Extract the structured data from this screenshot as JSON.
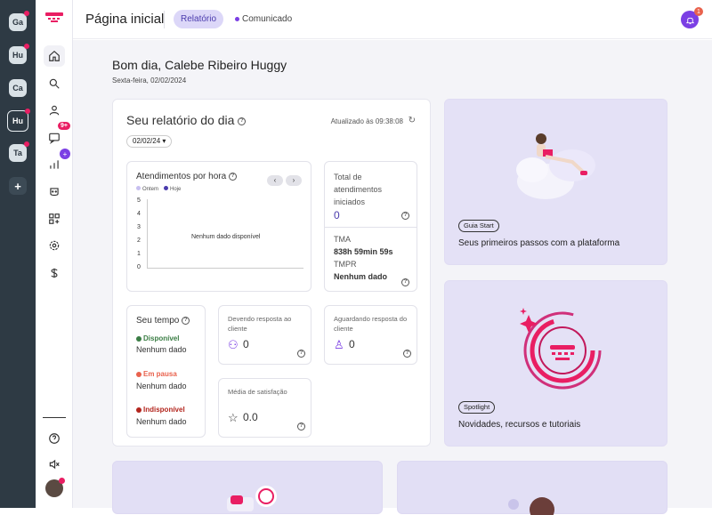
{
  "workspaces": [
    {
      "label": "Ga",
      "dot": true
    },
    {
      "label": "Hu",
      "dot": true
    },
    {
      "label": "Ca",
      "dot": false
    },
    {
      "label": "Hu",
      "dot": true,
      "active": true
    },
    {
      "label": "Ta",
      "dot": true
    }
  ],
  "workspace_add": "+",
  "nav": {
    "chat_badge": "9+",
    "stats_badge": "+"
  },
  "header": {
    "title": "Página inicial",
    "tab_report": "Relatório",
    "tab_notice": "Comunicado",
    "notification_count": "1"
  },
  "greeting": "Bom dia, Calebe Ribeiro Huggy",
  "date": "Sexta-feira, 02/02/2024",
  "report": {
    "title": "Seu relatório do dia",
    "updated": "Atualizado às 09:38:08",
    "date_select": "02/02/24",
    "hourly": {
      "title": "Atendimentos por hora",
      "legend_yesterday": "Ontem",
      "legend_today": "Hoje",
      "prev": "‹",
      "next": "›",
      "y_ticks": [
        "5",
        "4",
        "3",
        "2",
        "1",
        "0"
      ],
      "empty": "Nenhum dado disponível"
    },
    "total": {
      "label": "Total de atendimentos iniciados",
      "value": "0",
      "tma_label": "TMA",
      "tma_value": "838h 59min 59s",
      "tmpr_label": "TMPR",
      "tmpr_value": "Nenhum dado"
    },
    "tempo": {
      "title": "Seu tempo",
      "available": "Disponível",
      "available_value": "Nenhum dado",
      "paused": "Em pausa",
      "paused_value": "Nenhum dado",
      "unavailable": "Indisponível",
      "unavailable_value": "Nenhum dado"
    },
    "pending": {
      "label": "Devendo resposta ao cliente",
      "value": "0"
    },
    "waiting": {
      "label": "Aguardando resposta do cliente",
      "value": "0"
    },
    "satisfaction": {
      "label": "Média de satisfação",
      "value": "0.0"
    }
  },
  "side_cards": [
    {
      "tag": "Guia Start",
      "caption": "Seus primeiros passos com a plataforma"
    },
    {
      "tag": "Spotlight",
      "caption": "Novidades, recursos e tutoriais"
    }
  ],
  "colors": {
    "accent": "#7b3fe4",
    "dark_rail": "#2e3a44",
    "brand_pink": "#e91e63",
    "available": "#3a7d44",
    "paused": "#e9624d",
    "unavailable": "#b3261e"
  }
}
